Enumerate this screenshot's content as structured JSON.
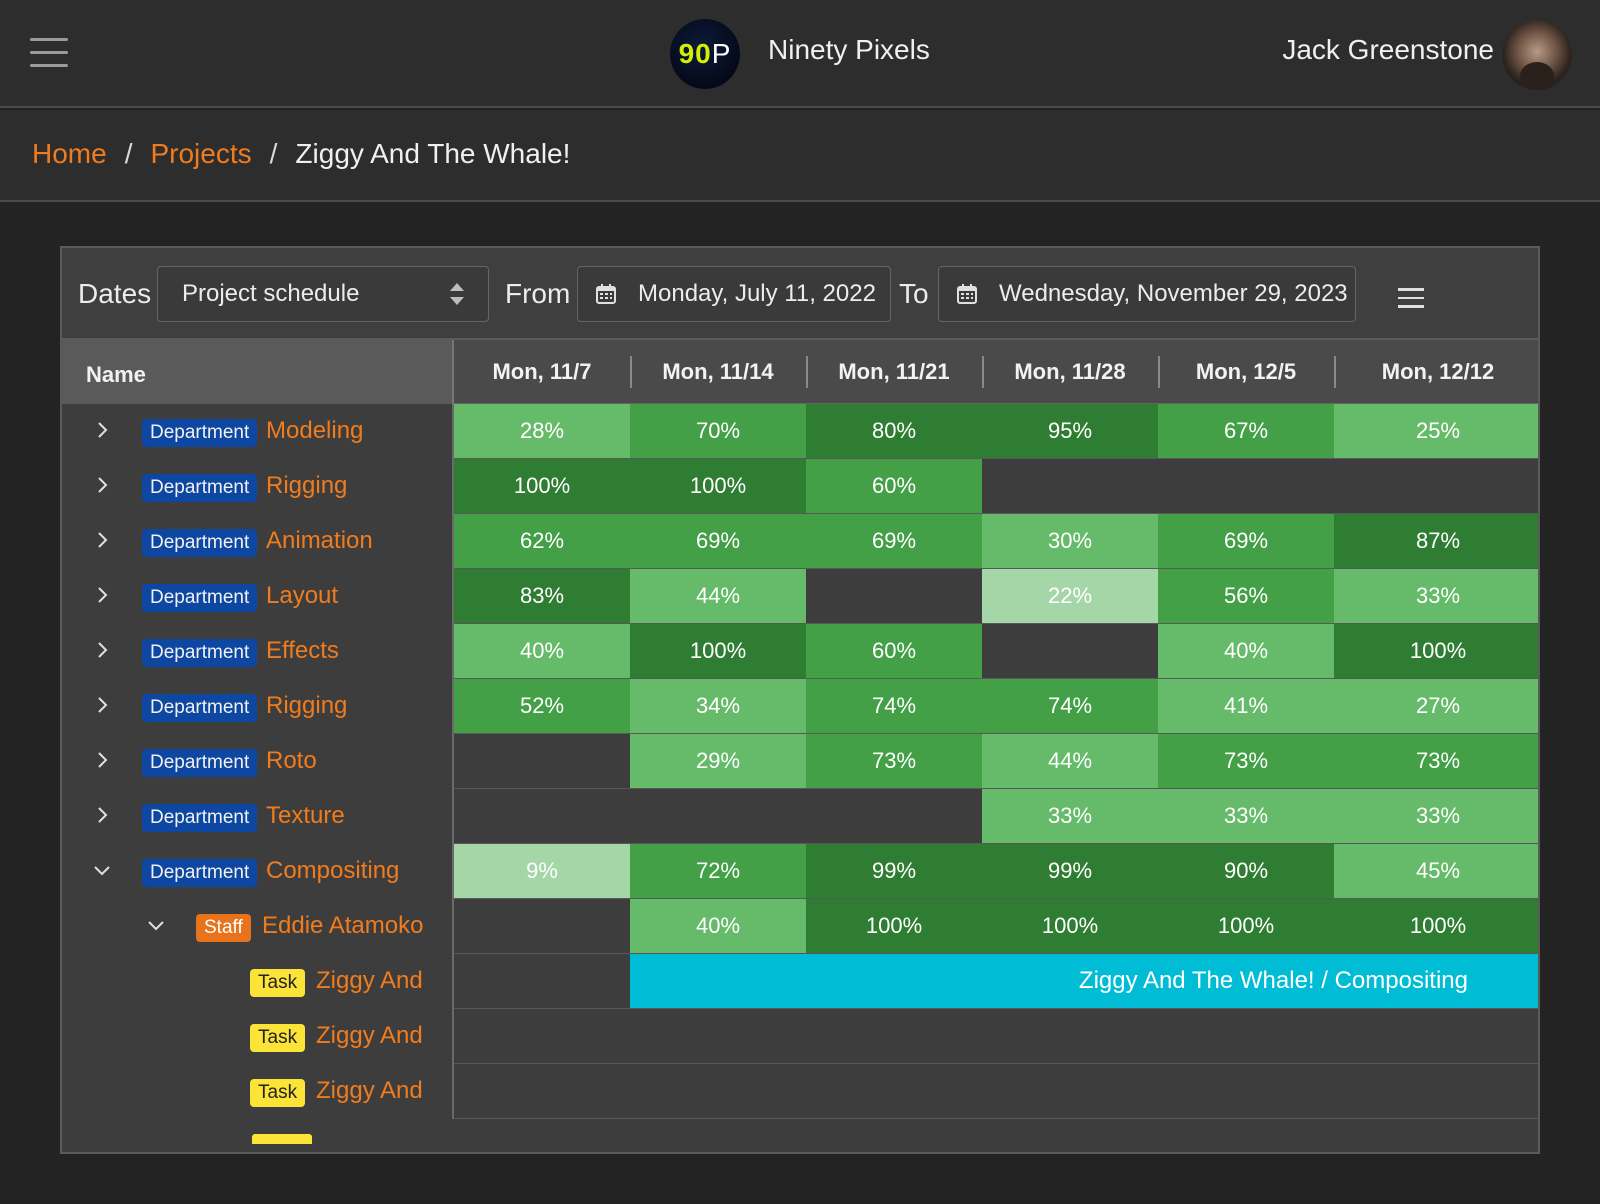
{
  "header": {
    "logo_main": "90",
    "logo_suffix": "P",
    "brand": "Ninety Pixels",
    "user": "Jack Greenstone"
  },
  "breadcrumb": {
    "home": "Home",
    "projects": "Projects",
    "current": "Ziggy And The Whale!",
    "separator": "/"
  },
  "toolbar": {
    "dates_label": "Dates",
    "select_value": "Project schedule",
    "from_label": "From",
    "from_date": "Monday, July 11, 2022",
    "to_label": "To",
    "to_date": "Wednesday, November 29, 2023"
  },
  "table": {
    "name_header": "Name",
    "columns": [
      "Mon, 11/7",
      "Mon, 11/14",
      "Mon, 11/21",
      "Mon, 11/28",
      "Mon, 12/5",
      "Mon, 12/12"
    ],
    "rows": [
      {
        "type": "Department",
        "name": "Modeling",
        "expanded": false,
        "level": 0,
        "values": [
          "28%",
          "70%",
          "80%",
          "95%",
          "67%",
          "25%"
        ]
      },
      {
        "type": "Department",
        "name": "Rigging",
        "expanded": false,
        "level": 0,
        "values": [
          "100%",
          "100%",
          "60%",
          "",
          "",
          ""
        ]
      },
      {
        "type": "Department",
        "name": "Animation",
        "expanded": false,
        "level": 0,
        "values": [
          "62%",
          "69%",
          "69%",
          "30%",
          "69%",
          "87%"
        ]
      },
      {
        "type": "Department",
        "name": "Layout",
        "expanded": false,
        "level": 0,
        "values": [
          "83%",
          "44%",
          "",
          "22%",
          "56%",
          "33%"
        ]
      },
      {
        "type": "Department",
        "name": "Effects",
        "expanded": false,
        "level": 0,
        "values": [
          "40%",
          "100%",
          "60%",
          "",
          "40%",
          "100%"
        ]
      },
      {
        "type": "Department",
        "name": "Rigging",
        "expanded": false,
        "level": 0,
        "values": [
          "52%",
          "34%",
          "74%",
          "74%",
          "41%",
          "27%"
        ]
      },
      {
        "type": "Department",
        "name": "Roto",
        "expanded": false,
        "level": 0,
        "values": [
          "",
          "29%",
          "73%",
          "44%",
          "73%",
          "73%"
        ]
      },
      {
        "type": "Department",
        "name": "Texture",
        "expanded": false,
        "level": 0,
        "values": [
          "",
          "",
          "",
          "33%",
          "33%",
          "33%"
        ]
      },
      {
        "type": "Department",
        "name": "Compositing",
        "expanded": true,
        "level": 0,
        "values": [
          "9%",
          "72%",
          "99%",
          "99%",
          "90%",
          "45%"
        ]
      },
      {
        "type": "Staff",
        "name": "Eddie Atamoko",
        "expanded": true,
        "level": 1,
        "values": [
          "",
          "40%",
          "100%",
          "100%",
          "100%",
          "100%"
        ]
      },
      {
        "type": "Task",
        "name": "Ziggy And",
        "level": 2,
        "bar": "Ziggy And The Whale! / Compositing",
        "bar_start_col": 1
      },
      {
        "type": "Task",
        "name": "Ziggy And",
        "level": 2
      },
      {
        "type": "Task",
        "name": "Ziggy And",
        "level": 2
      }
    ]
  },
  "colors": {
    "orange": "#f07c1e",
    "dept_badge": "#0d47a1",
    "staff_badge": "#e8731b",
    "task_badge": "#fbe437",
    "task_bar": "#00bcd4",
    "green_dark": "#2e7d32",
    "green_mid": "#43a047",
    "green_light": "#66bb6a",
    "green_pale": "#a5d6a7"
  }
}
